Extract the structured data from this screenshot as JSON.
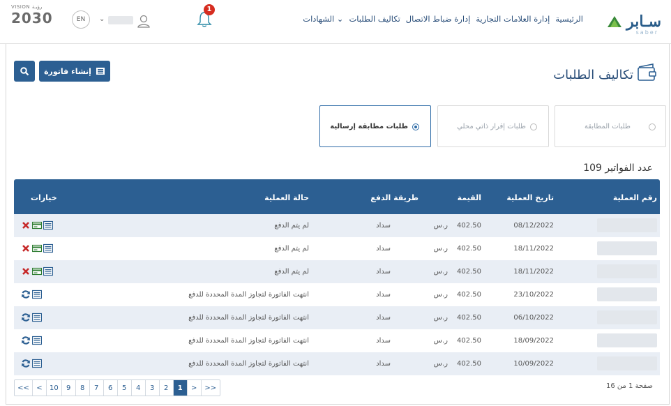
{
  "nav": {
    "logo": "سـابر",
    "logo_sub": "saber",
    "menu": [
      "الرئيسية",
      "إدارة العلامات التجارية",
      "إدارة ضباط الاتصال",
      "تكاليف الطلبات",
      "الشهادات ⌄"
    ],
    "notification_count": "1",
    "language": "EN",
    "vision_top": "VISION رؤيـة",
    "vision_year": "2030"
  },
  "page": {
    "title": "تكاليف الطلبات",
    "invoice_button": "إنشاء فاتورة"
  },
  "filter_tabs": [
    {
      "label": "طلبات المطابقة",
      "active": false
    },
    {
      "label": "طلبات إقرار ذاتي محلي",
      "active": false
    },
    {
      "label": "طلبات مطابقة إرسالية",
      "active": true
    }
  ],
  "invoice_count": "عدد الفواتير 109",
  "table": {
    "headers": {
      "txn_no": "رقم العملية",
      "txn_date": "تاريخ العملية",
      "amount": "القيمة",
      "pay_method": "طريقة الدفع",
      "status": "حالة العملية",
      "options": "خيارات"
    },
    "currency": "ر.س",
    "rows": [
      {
        "date": "08/12/2022",
        "amount": "402.50",
        "method": "سداد",
        "status": "لم يتم الدفع",
        "ops": "unpaid"
      },
      {
        "date": "18/11/2022",
        "amount": "402.50",
        "method": "سداد",
        "status": "لم يتم الدفع",
        "ops": "unpaid"
      },
      {
        "date": "18/11/2022",
        "amount": "402.50",
        "method": "سداد",
        "status": "لم يتم الدفع",
        "ops": "unpaid"
      },
      {
        "date": "23/10/2022",
        "amount": "402.50",
        "method": "سداد",
        "status": "انتهت الفاتورة لتجاوز المدة المحددة للدفع",
        "ops": "expired"
      },
      {
        "date": "06/10/2022",
        "amount": "402.50",
        "method": "سداد",
        "status": "انتهت الفاتورة لتجاوز المدة المحددة للدفع",
        "ops": "expired"
      },
      {
        "date": "18/09/2022",
        "amount": "402.50",
        "method": "سداد",
        "status": "انتهت الفاتورة لتجاوز المدة المحددة للدفع",
        "ops": "expired"
      },
      {
        "date": "10/09/2022",
        "amount": "402.50",
        "method": "سداد",
        "status": "انتهت الفاتورة لتجاوز المدة المحددة للدفع",
        "ops": "expired"
      }
    ]
  },
  "pagination": {
    "buttons": [
      "<<",
      "<",
      "10",
      "9",
      "8",
      "7",
      "6",
      "5",
      "4",
      "3",
      "2",
      "1",
      ">",
      ">>"
    ],
    "active": "1",
    "info": "صفحة 1 من 16"
  },
  "colors": {
    "primary": "#2c5f92",
    "row_alt": "#e9eef5",
    "badge": "#d62d20",
    "delete": "#c62828",
    "card": "#2e7d32",
    "refresh": "#2c5f92"
  },
  "icons": {
    "search": "search-icon",
    "invoice": "invoice-icon",
    "bell": "bell-icon",
    "user": "user-icon",
    "page": "wallet-icon",
    "ops_unpaid": [
      "delete-icon",
      "payment-card-icon",
      "details-icon"
    ],
    "ops_expired": [
      "refresh-icon",
      "details-icon"
    ]
  }
}
